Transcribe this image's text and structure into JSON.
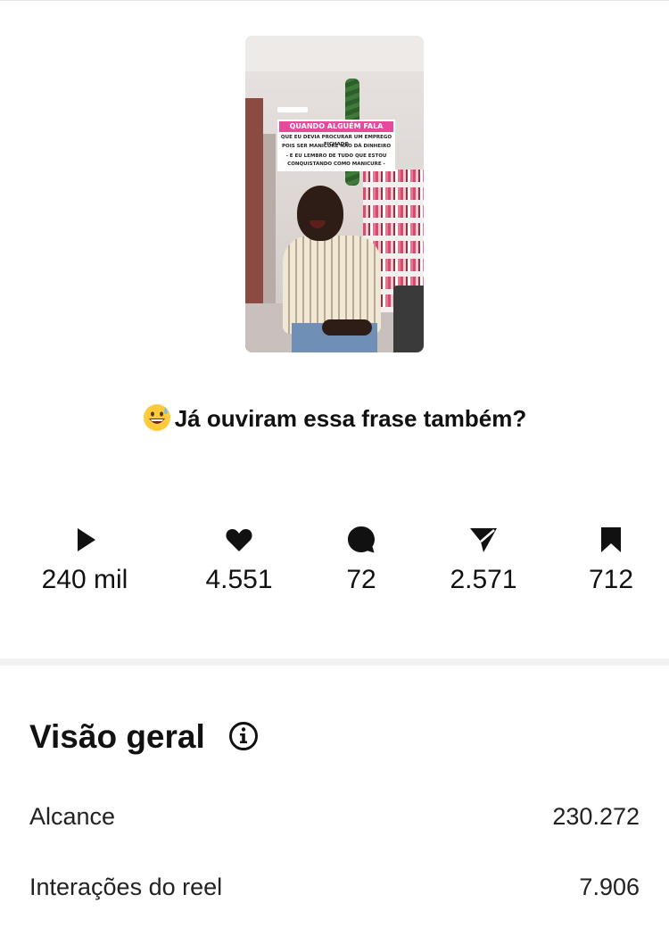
{
  "thumbnail": {
    "headline": "QUANDO ALGUÉM FALA",
    "lines": [
      "QUE EU DEVIA PROCURAR UM EMPREGO FICHADO",
      "POIS SER MANICURE NÃO DÁ DINHEIRO",
      "- E EU LEMBRO DE TUDO QUE ESTOU",
      "CONQUISTANDO COMO MANICURE -"
    ]
  },
  "caption": {
    "emoji": "grinning-face-with-sweat",
    "text": "Já ouviram essa frase também?"
  },
  "stats": [
    {
      "icon": "play-icon",
      "value": "240 mil"
    },
    {
      "icon": "heart-icon",
      "value": "4.551"
    },
    {
      "icon": "comment-icon",
      "value": "72"
    },
    {
      "icon": "share-icon",
      "value": "2.571"
    },
    {
      "icon": "bookmark-icon",
      "value": "712"
    }
  ],
  "overview": {
    "title": "Visão geral",
    "info_icon": "info-icon",
    "metrics": [
      {
        "label": "Alcance",
        "value": "230.272"
      },
      {
        "label": "Interações do reel",
        "value": "7.906"
      }
    ]
  }
}
